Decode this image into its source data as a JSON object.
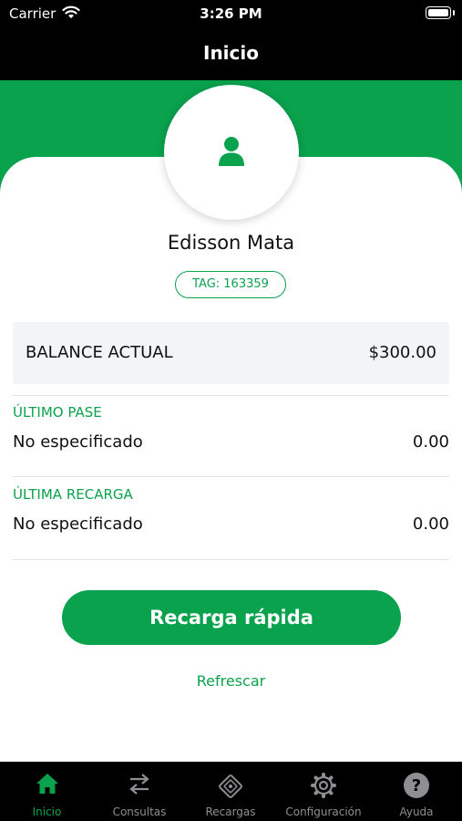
{
  "status_bar": {
    "carrier": "Carrier",
    "time": "3:26 PM"
  },
  "nav": {
    "title": "Inicio"
  },
  "profile": {
    "name": "Edisson Mata",
    "tag": "TAG: 163359",
    "avatar_icon": "person-icon"
  },
  "balance": {
    "label": "BALANCE ACTUAL",
    "value": "$300.00"
  },
  "last_pass": {
    "title": "ÚLTIMO PASE",
    "description": "No especificado",
    "amount": "0.00"
  },
  "last_recharge": {
    "title": "ÚLTIMA RECARGA",
    "description": "No especificado",
    "amount": "0.00"
  },
  "actions": {
    "quick_recharge": "Recarga rápida",
    "refresh": "Refrescar"
  },
  "tabs": [
    {
      "label": "Inicio",
      "icon": "home-icon",
      "active": true
    },
    {
      "label": "Consultas",
      "icon": "swap-arrows-icon",
      "active": false
    },
    {
      "label": "Recargas",
      "icon": "card-icon",
      "active": false
    },
    {
      "label": "Configuración",
      "icon": "gear-icon",
      "active": false
    },
    {
      "label": "Ayuda",
      "icon": "help-icon",
      "active": false
    }
  ],
  "colors": {
    "accent": "#0aa24d",
    "bar_background": "#000000",
    "inactive_tab": "#8e8e93",
    "balance_background": "#f3f4f6"
  }
}
